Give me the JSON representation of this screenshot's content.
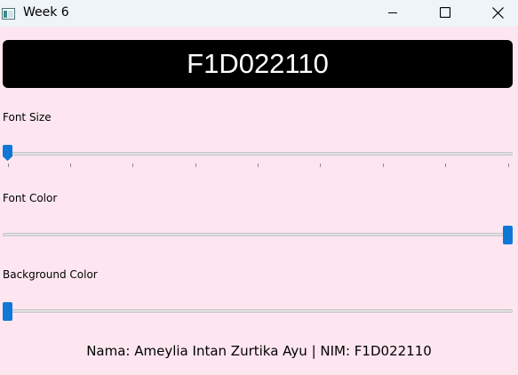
{
  "window": {
    "title": "Week 6",
    "background": "#fde6ef",
    "icons": {
      "app": "app-window-icon",
      "minimize": "minimize-icon",
      "maximize": "maximize-icon",
      "close": "close-icon"
    }
  },
  "display": {
    "text": "F1D022110",
    "background": "#000000",
    "text_color": "#ffffff"
  },
  "controls": {
    "font_size": {
      "label": "Font Size",
      "value_fraction": 0.0,
      "tick_count": 9
    },
    "font_color": {
      "label": "Font Color",
      "value_fraction": 1.0
    },
    "background_color": {
      "label": "Background Color",
      "value_fraction": 0.0
    },
    "accent": "#0f78d7"
  },
  "footer": {
    "text": "Nama: Ameylia Intan Zurtika Ayu | NIM: F1D022110"
  }
}
